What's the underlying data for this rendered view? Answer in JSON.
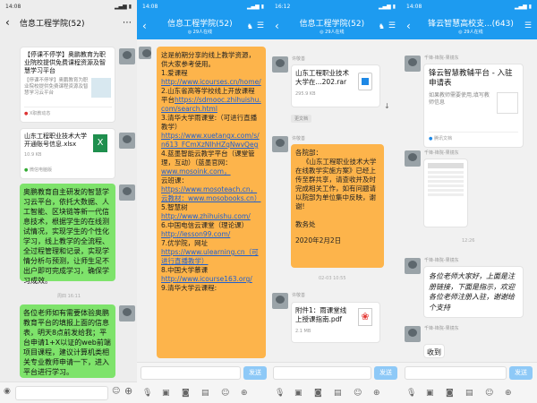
{
  "s1": {
    "time": "14:08",
    "title": "信息工程学院(52)",
    "card1": {
      "title": "【停课不停学】奥鹏教育为职业院校提供免费课程资源及智慧学习平台",
      "desc": "【停课不停学】奥鹏教育为职业院校提供免费课程资源及智慧学习云平台",
      "source": "X职教动态"
    },
    "file1": {
      "name": "山东工程职业技术大学开通账号信息.xlsx",
      "size": "10.9 KB",
      "source": "微信电脑版"
    },
    "msg1": "奥鹏教育自主研发的智慧学习云平台，依托大数据、人工智能、区块链等新一代信息技术，根据学生的在线测试情况，实现学生的个性化学习，线上教学的全流程、全过程管理和记录，实现学情分析与预测，让师生足不出户即可完成学习，确保学习成效。",
    "time_chip": "周四 16:11",
    "msg2": "各位老师如有需要体验奥鹏教育平台的填报上面的信息表，明天8点前发给我；平台申请1+X以证的web前端项目课程，建议计算机类相关专业教师申请一下，进入平台进行学习。"
  },
  "s2": {
    "time": "14:08",
    "title": "信息工程学院(52)",
    "subtitle": "◎ 29人在线",
    "intro": "这是前期分享的线上教学资源，供大家参考使用。",
    "items": [
      {
        "t": "1.爱课程",
        "u": "http://www.icourses.cn/home/"
      },
      {
        "t": "2.山东省高等学校线上开放课程平台",
        "u": "https://sdmooc.zhihuishu.com/search.html"
      },
      {
        "t": "3.清华大学雨课堂:（可进行直播教学）",
        "u": "https://www.xuetangx.com/s/n613_FCmXzNIhHZqNwvQeg"
      },
      {
        "t": "4.蓝墨智能云教学平台（课堂管理，互动）（蓝墨官网：",
        "u": "www.mosoink.com，"
      },
      {
        "t": "云班课：",
        "u": "https://www.mosoteach.cn，云教材：www.mosobooks.cn）"
      },
      {
        "t": "5.智慧树",
        "u": "http://www.zhihuishu.com/"
      },
      {
        "t": "6.中国电信云课堂（理论课）",
        "u": "http://lesson99.com/"
      },
      {
        "t": "7.优学院，网址",
        "u": "https://www.ulearning.cn（可进行直播教学）"
      },
      {
        "t": "8.中国大学慕课",
        "u": "http://www.icourse163.org/"
      },
      {
        "t": "9.清华大学云课程:",
        "u": ""
      }
    ],
    "send": "发送"
  },
  "s3": {
    "time": "16:12",
    "title": "信息工程学院(52)",
    "subtitle": "◎ 29人在线",
    "sender1": "许敬善",
    "file1": {
      "name": "山东工程职业技术大学在...202.rar",
      "size": "295.9 KB"
    },
    "chip": "更文档",
    "sender2": "许敬善",
    "notice": {
      "greeting": "各院部：",
      "body": "《山东工程职业技术大学在线教学实施方案》已经上传至群共享，请查收并及时完成相关工作，如有问题请以院部为单位集中反映，谢谢!",
      "sign": "教务处",
      "date": "2020年2月2日"
    },
    "time_chip": "02-03 10:55",
    "sender3": "许敬善",
    "file2": {
      "name": "附件1：雨课堂线上授课指南.pdf",
      "size": "2.1 MB"
    },
    "send": "发送"
  },
  "s4": {
    "time": "14:08",
    "title": "锋云智慧高校支...(643)",
    "subtitle": "◎ 29人在线",
    "sender1": "千锋-锋院-果镜东",
    "card": {
      "title": "锋云智慧教辅平台 - 入驻申请表",
      "desc": "如果教师需要使用,填写教师信息",
      "source": "腾讯文档"
    },
    "sender2": "千锋-锋院-果镜东",
    "time_chip": "12:26",
    "sender3": "千锋-锋院-果镜东",
    "msg": "各位老师大家好，上面是注册链接，下面是指示，欢迎各位老师注册入驻，谢谢给个支持",
    "sender4": "千锋-锋院-果镜东",
    "reply": "收到",
    "send": "发送"
  }
}
